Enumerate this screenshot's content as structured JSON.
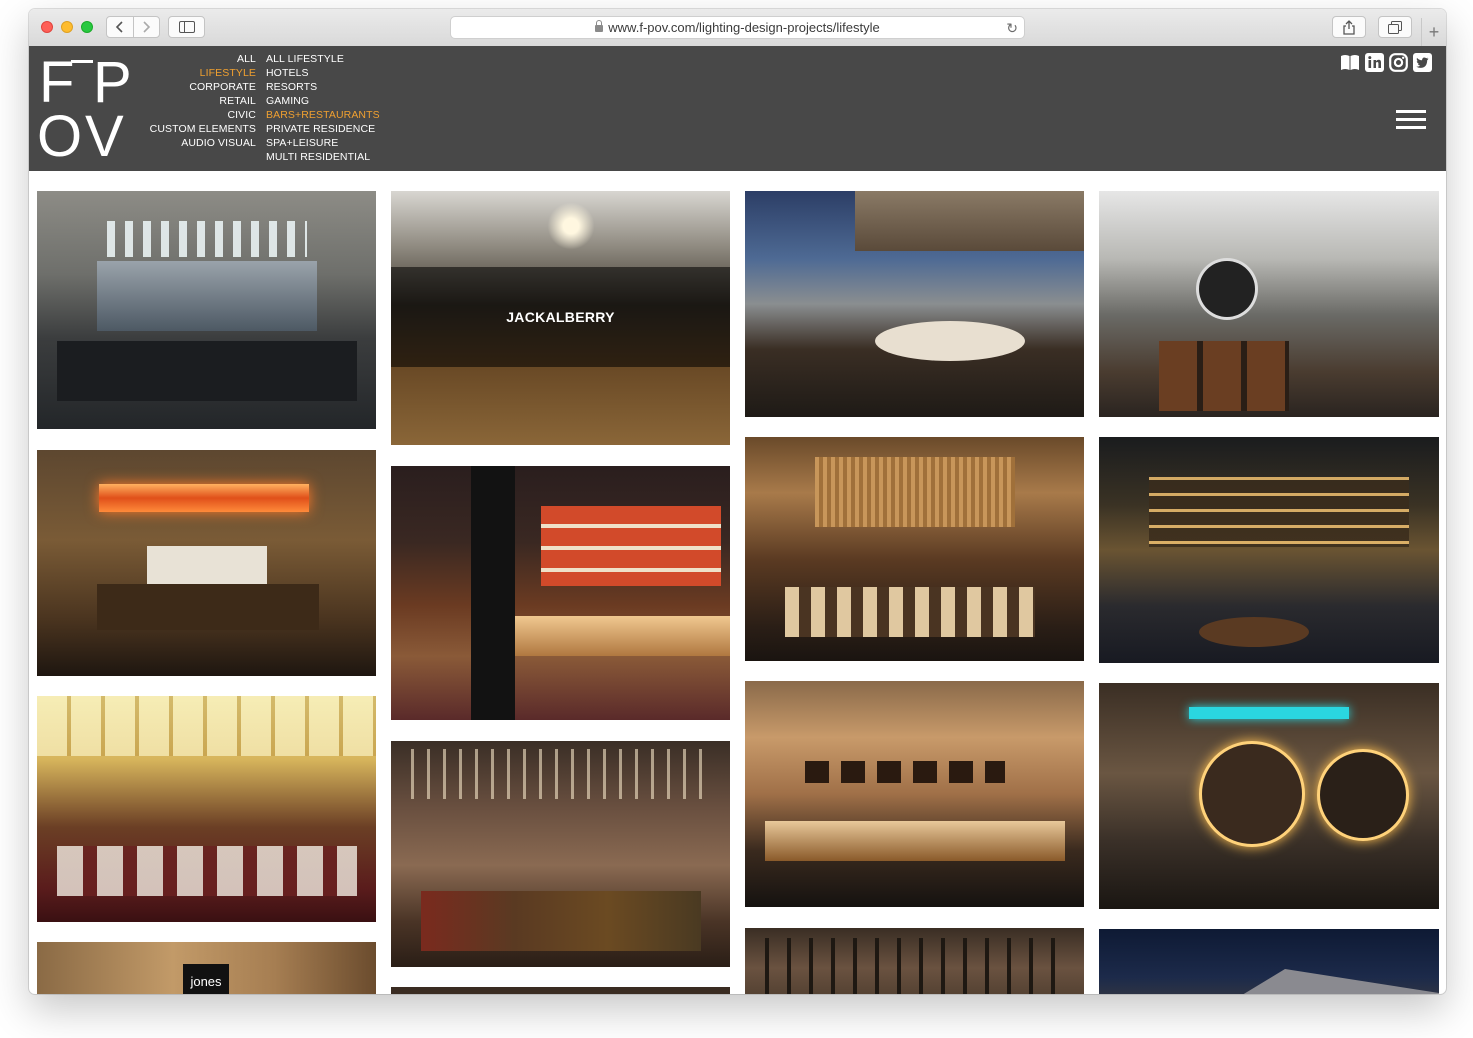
{
  "browser": {
    "url": "www.f-pov.com/lighting-design-projects/lifestyle",
    "new_tab": "+"
  },
  "logo": {
    "letters": [
      "F",
      "P",
      "O",
      "V"
    ]
  },
  "menu": {
    "categories": [
      {
        "label": "ALL",
        "active": false
      },
      {
        "label": "LIFESTYLE",
        "active": true
      },
      {
        "label": "CORPORATE",
        "active": false
      },
      {
        "label": "RETAIL",
        "active": false
      },
      {
        "label": "CIVIC",
        "active": false
      },
      {
        "label": "CUSTOM ELEMENTS",
        "active": false
      },
      {
        "label": "AUDIO VISUAL",
        "active": false
      }
    ],
    "subcategories": [
      {
        "label": "ALL LIFESTYLE",
        "active": false
      },
      {
        "label": "HOTELS",
        "active": false
      },
      {
        "label": "RESORTS",
        "active": false
      },
      {
        "label": "GAMING",
        "active": false
      },
      {
        "label": "BARS+RESTAURANTS",
        "active": true
      },
      {
        "label": "PRIVATE RESIDENCE",
        "active": false
      },
      {
        "label": "SPA+LEISURE",
        "active": false
      },
      {
        "label": "MULTI RESIDENTIAL",
        "active": false
      }
    ]
  },
  "social_icons": [
    "book-icon",
    "linkedin-icon",
    "instagram-icon",
    "twitter-icon"
  ],
  "colors": {
    "header_bg": "#484848",
    "active_menu": "#f0a030",
    "text": "#ffffff"
  },
  "gallery": {
    "hover_caption": "JACKALBERRY",
    "sign_text": "jones"
  }
}
